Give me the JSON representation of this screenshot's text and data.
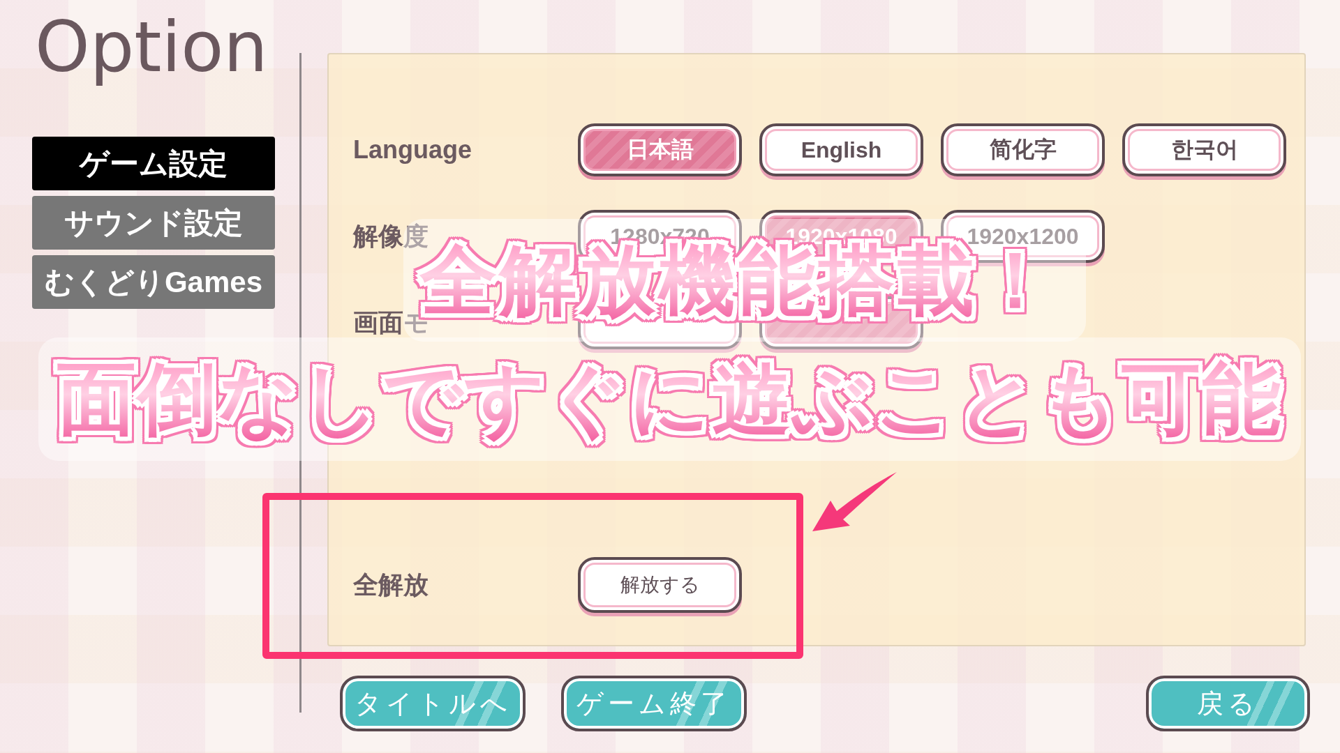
{
  "title": "Option",
  "sidebar": {
    "tabs": [
      {
        "label": "ゲーム設定",
        "selected": true
      },
      {
        "label": "サウンド設定",
        "selected": false
      },
      {
        "label": "むくどりGames",
        "selected": false
      }
    ]
  },
  "settings": [
    {
      "label": "Language",
      "options": [
        {
          "label": "日本語",
          "selected": true
        },
        {
          "label": "English",
          "selected": false
        },
        {
          "label": "简化字",
          "selected": false
        },
        {
          "label": "한국어",
          "selected": false
        }
      ]
    },
    {
      "label": "解像度",
      "options": [
        {
          "label": "1280x720",
          "selected": false
        },
        {
          "label": "1920x1080",
          "selected": true
        },
        {
          "label": "1920x1200",
          "selected": false
        }
      ]
    },
    {
      "label": "画面モ",
      "options": [
        {
          "selected": false
        },
        {
          "selected": true
        }
      ]
    }
  ],
  "unlock_all": {
    "label": "全解放",
    "button": "解放する"
  },
  "footer_buttons": [
    {
      "label": "タイトルへ"
    },
    {
      "label": "ゲーム終了"
    },
    {
      "label": "戻る"
    }
  ],
  "promo_banners": [
    {
      "text": "全解放機能搭載！"
    },
    {
      "text": "面倒なしですぐに遊ぶことも可能"
    }
  ]
}
